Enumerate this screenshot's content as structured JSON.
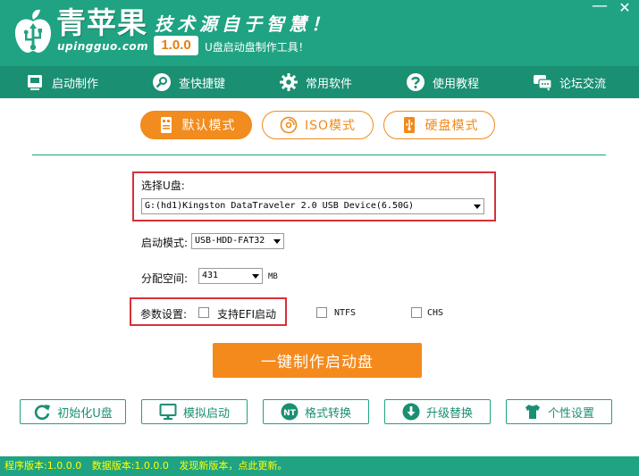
{
  "header": {
    "brand_name": "青苹果",
    "brand_domain": "upingguo.com",
    "slogan": "技术源自于智慧！",
    "version_badge": "1.0.0",
    "tagline": "U盘启动盘制作工具！",
    "minimize_glyph": "—",
    "close_glyph": "✕"
  },
  "nav": [
    {
      "label": "启动制作",
      "icon": "usb-drive-icon"
    },
    {
      "label": "查快捷键",
      "icon": "key-search-icon"
    },
    {
      "label": "常用软件",
      "icon": "gear-icon"
    },
    {
      "label": "使用教程",
      "icon": "help-icon"
    },
    {
      "label": "论坛交流",
      "icon": "chat-icon"
    }
  ],
  "modes": [
    {
      "label": "默认模式",
      "icon": "usb-icon",
      "active": true
    },
    {
      "label": "ISO模式",
      "icon": "disc-icon",
      "active": false
    },
    {
      "label": "硬盘模式",
      "icon": "hard-disk-icon",
      "active": false
    }
  ],
  "form": {
    "usb_label": "选择U盘:",
    "usb_value": "G:(hd1)Kingston DataTraveler 2.0 USB Device(6.50G)",
    "boot_mode_label": "启动模式:",
    "boot_mode_value": "USB-HDD-FAT32",
    "alloc_label": "分配空间:",
    "alloc_value": "431",
    "alloc_unit": "MB",
    "params_label": "参数设置:",
    "efi_label": "支持EFI启动",
    "efi_checked": false,
    "ntfs_label": "NTFS",
    "ntfs_checked": false,
    "chs_label": "CHS",
    "chs_checked": false,
    "primary_button": "一键制作启动盘"
  },
  "tools": [
    {
      "label": "初始化U盘",
      "icon": "refresh-icon"
    },
    {
      "label": "模拟启动",
      "icon": "monitor-icon"
    },
    {
      "label": "格式转换",
      "icon": "nt-convert-icon"
    },
    {
      "label": "升级替换",
      "icon": "download-icon"
    },
    {
      "label": "个性设置",
      "icon": "tshirt-icon"
    }
  ],
  "status": {
    "program_version": "程序版本:1.0.0.0",
    "data_version": "数据版本:1.0.0.0",
    "update_notice": "发现新版本，点此更新。"
  },
  "colors": {
    "brand_green": "#1fa382",
    "nav_green": "#1a8f72",
    "accent_orange": "#f28c1e",
    "highlight_red": "#d9303a",
    "status_text": "#ffff00"
  }
}
